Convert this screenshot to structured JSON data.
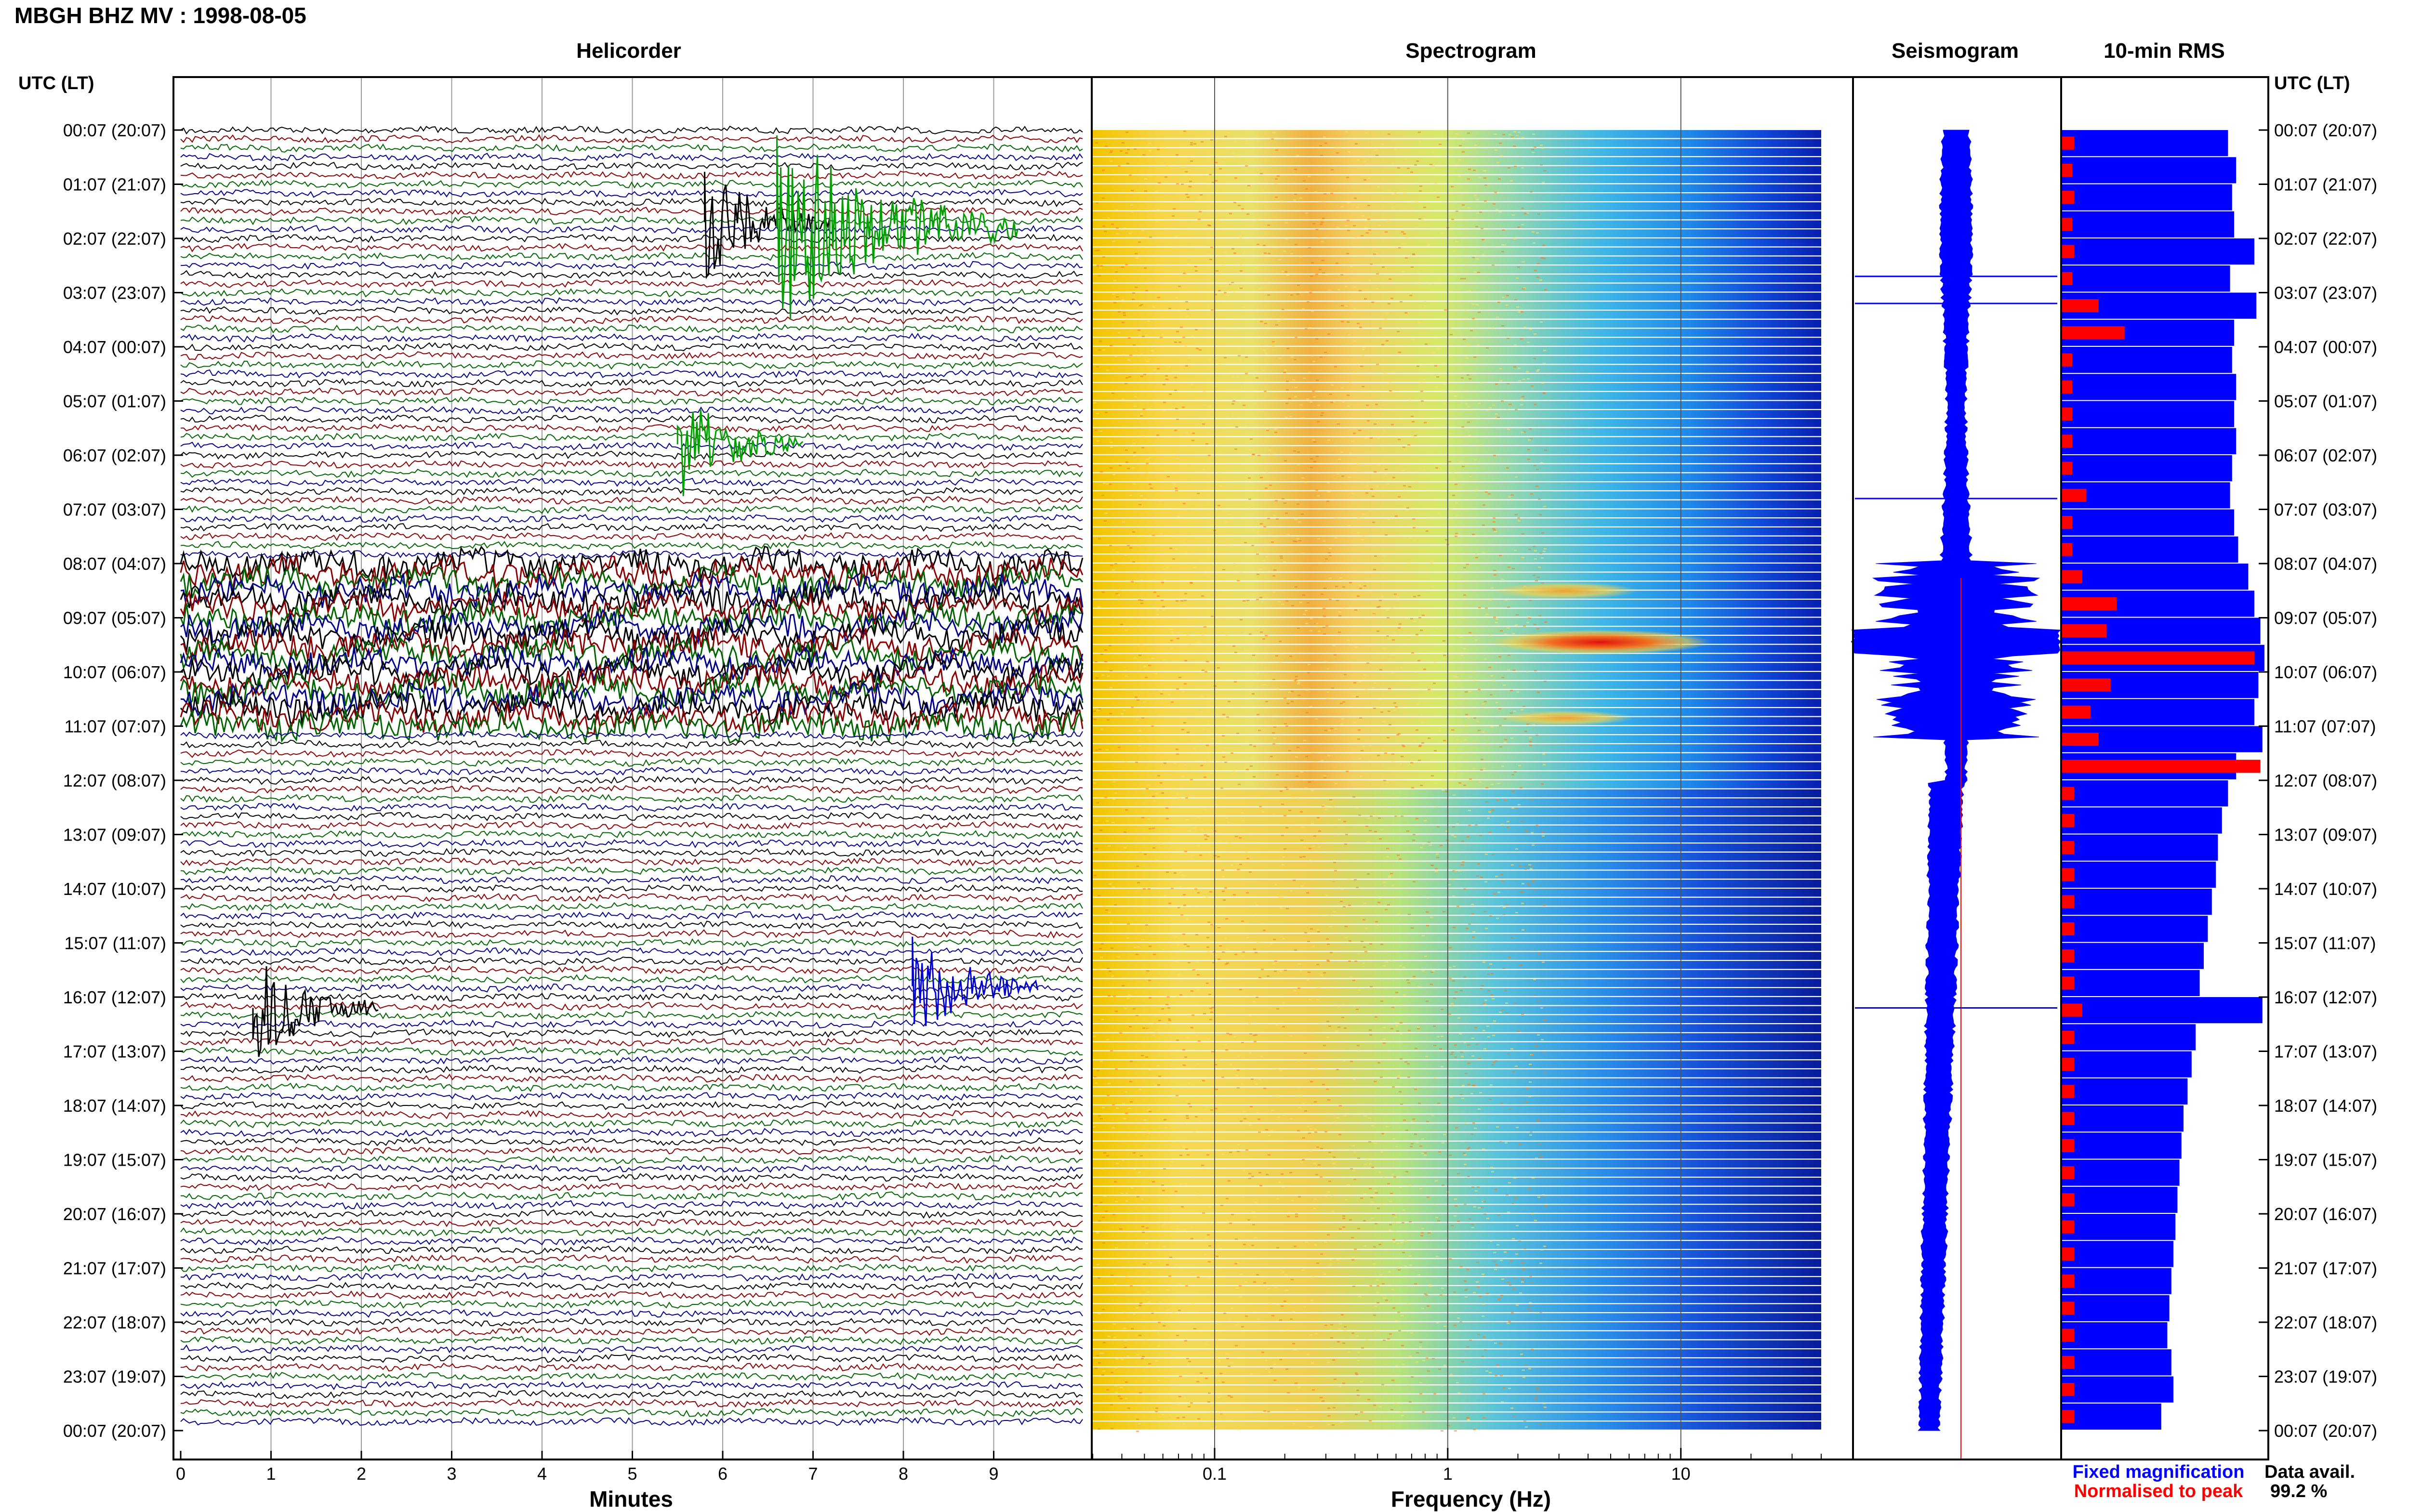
{
  "title": "MBGH BHZ MV : 1998-08-05",
  "panels": {
    "helicorder": "Helicorder",
    "spectrogram": "Spectrogram",
    "seismogram": "Seismogram",
    "rms": "10-min RMS"
  },
  "left_axis_label": "UTC (LT)",
  "right_axis_label": "UTC (LT)",
  "time_labels": [
    "00:07 (20:07)",
    "01:07 (21:07)",
    "02:07 (22:07)",
    "03:07 (23:07)",
    "04:07 (00:07)",
    "05:07 (01:07)",
    "06:07 (02:07)",
    "07:07 (03:07)",
    "08:07 (04:07)",
    "09:07 (05:07)",
    "10:07 (06:07)",
    "11:07 (07:07)",
    "12:07 (08:07)",
    "13:07 (09:07)",
    "14:07 (10:07)",
    "15:07 (11:07)",
    "16:07 (12:07)",
    "17:07 (13:07)",
    "18:07 (14:07)",
    "19:07 (15:07)",
    "20:07 (16:07)",
    "21:07 (17:07)",
    "22:07 (18:07)",
    "23:07 (19:07)",
    "00:07 (20:07)"
  ],
  "minutes_axis": {
    "label": "Minutes",
    "ticks": [
      "0",
      "1",
      "2",
      "3",
      "4",
      "5",
      "6",
      "7",
      "8",
      "9"
    ]
  },
  "frequency_axis": {
    "label": "Frequency (Hz)",
    "ticks": [
      "0.1",
      "1",
      "10"
    ],
    "scale": "log",
    "range": [
      0.03,
      40
    ]
  },
  "legend": {
    "fixed": "Fixed magnification",
    "normalised": "Normalised to peak",
    "fixed_color": "#0000ff",
    "normalised_color": "#ff0000"
  },
  "availability": {
    "label": "Data avail.",
    "value": "99.2 %"
  },
  "trace_colors": [
    "#000000",
    "#8b0000",
    "#006400",
    "#00008b"
  ],
  "chart_data": {
    "type": "heatmap",
    "x_minutes_range": [
      0,
      10
    ],
    "hours": 24,
    "events": [
      {
        "hour": 1.7,
        "minute": 5.8,
        "color": "black"
      },
      {
        "hour": 1.8,
        "minute": 6.6,
        "color": "green"
      },
      {
        "hour": 5.8,
        "minute": 5.5,
        "color": "green"
      },
      {
        "hour": 15.8,
        "minute": 8.1,
        "color": "blue"
      },
      {
        "hour": 16.2,
        "minute": 0.8,
        "color": "black"
      }
    ],
    "high_noise_hours": [
      8.0,
      11.0
    ],
    "rms_fixed": [
      {
        "hour": 0.0,
        "value": 0.82
      },
      {
        "hour": 0.5,
        "value": 0.86
      },
      {
        "hour": 1.0,
        "value": 0.84
      },
      {
        "hour": 1.5,
        "value": 0.85
      },
      {
        "hour": 2.0,
        "value": 0.95
      },
      {
        "hour": 2.5,
        "value": 0.83
      },
      {
        "hour": 3.0,
        "value": 0.96
      },
      {
        "hour": 3.5,
        "value": 0.85
      },
      {
        "hour": 4.0,
        "value": 0.84
      },
      {
        "hour": 4.5,
        "value": 0.86
      },
      {
        "hour": 5.0,
        "value": 0.85
      },
      {
        "hour": 5.5,
        "value": 0.86
      },
      {
        "hour": 6.0,
        "value": 0.84
      },
      {
        "hour": 6.5,
        "value": 0.83
      },
      {
        "hour": 7.0,
        "value": 0.85
      },
      {
        "hour": 7.5,
        "value": 0.87
      },
      {
        "hour": 8.0,
        "value": 0.92
      },
      {
        "hour": 8.5,
        "value": 0.95
      },
      {
        "hour": 9.0,
        "value": 0.98
      },
      {
        "hour": 9.5,
        "value": 1.0
      },
      {
        "hour": 10.0,
        "value": 0.97
      },
      {
        "hour": 10.5,
        "value": 0.95
      },
      {
        "hour": 11.0,
        "value": 0.99
      },
      {
        "hour": 11.5,
        "value": 0.86
      },
      {
        "hour": 12.0,
        "value": 0.82
      },
      {
        "hour": 12.5,
        "value": 0.79
      },
      {
        "hour": 13.0,
        "value": 0.77
      },
      {
        "hour": 13.5,
        "value": 0.76
      },
      {
        "hour": 14.0,
        "value": 0.74
      },
      {
        "hour": 14.5,
        "value": 0.72
      },
      {
        "hour": 15.0,
        "value": 0.7
      },
      {
        "hour": 15.5,
        "value": 0.68
      },
      {
        "hour": 16.0,
        "value": 0.99
      },
      {
        "hour": 16.5,
        "value": 0.66
      },
      {
        "hour": 17.0,
        "value": 0.64
      },
      {
        "hour": 17.5,
        "value": 0.62
      },
      {
        "hour": 18.0,
        "value": 0.6
      },
      {
        "hour": 18.5,
        "value": 0.59
      },
      {
        "hour": 19.0,
        "value": 0.58
      },
      {
        "hour": 19.5,
        "value": 0.57
      },
      {
        "hour": 20.0,
        "value": 0.56
      },
      {
        "hour": 20.5,
        "value": 0.55
      },
      {
        "hour": 21.0,
        "value": 0.54
      },
      {
        "hour": 21.5,
        "value": 0.53
      },
      {
        "hour": 22.0,
        "value": 0.52
      },
      {
        "hour": 22.5,
        "value": 0.54
      },
      {
        "hour": 23.0,
        "value": 0.55
      },
      {
        "hour": 23.5,
        "value": 0.49
      }
    ],
    "rms_normalised": [
      {
        "hour": 0.0,
        "value": 0.06
      },
      {
        "hour": 0.5,
        "value": 0.05
      },
      {
        "hour": 1.0,
        "value": 0.06
      },
      {
        "hour": 1.5,
        "value": 0.05
      },
      {
        "hour": 2.0,
        "value": 0.06
      },
      {
        "hour": 2.5,
        "value": 0.05
      },
      {
        "hour": 3.0,
        "value": 0.18
      },
      {
        "hour": 3.5,
        "value": 0.31
      },
      {
        "hour": 4.0,
        "value": 0.05
      },
      {
        "hour": 4.5,
        "value": 0.05
      },
      {
        "hour": 5.0,
        "value": 0.05
      },
      {
        "hour": 5.5,
        "value": 0.05
      },
      {
        "hour": 6.0,
        "value": 0.05
      },
      {
        "hour": 6.5,
        "value": 0.12
      },
      {
        "hour": 7.0,
        "value": 0.05
      },
      {
        "hour": 7.5,
        "value": 0.05
      },
      {
        "hour": 8.0,
        "value": 0.1
      },
      {
        "hour": 8.5,
        "value": 0.27
      },
      {
        "hour": 9.0,
        "value": 0.22
      },
      {
        "hour": 9.5,
        "value": 0.95
      },
      {
        "hour": 10.0,
        "value": 0.24
      },
      {
        "hour": 10.5,
        "value": 0.14
      },
      {
        "hour": 11.0,
        "value": 0.18
      },
      {
        "hour": 11.5,
        "value": 0.98
      },
      {
        "hour": 12.0,
        "value": 0.06
      },
      {
        "hour": 12.5,
        "value": 0.06
      },
      {
        "hour": 13.0,
        "value": 0.06
      },
      {
        "hour": 13.5,
        "value": 0.06
      },
      {
        "hour": 14.0,
        "value": 0.06
      },
      {
        "hour": 14.5,
        "value": 0.06
      },
      {
        "hour": 15.0,
        "value": 0.06
      },
      {
        "hour": 15.5,
        "value": 0.06
      },
      {
        "hour": 16.0,
        "value": 0.1
      },
      {
        "hour": 16.5,
        "value": 0.06
      },
      {
        "hour": 17.0,
        "value": 0.06
      },
      {
        "hour": 17.5,
        "value": 0.06
      },
      {
        "hour": 18.0,
        "value": 0.06
      },
      {
        "hour": 18.5,
        "value": 0.06
      },
      {
        "hour": 19.0,
        "value": 0.06
      },
      {
        "hour": 19.5,
        "value": 0.06
      },
      {
        "hour": 20.0,
        "value": 0.06
      },
      {
        "hour": 20.5,
        "value": 0.06
      },
      {
        "hour": 21.0,
        "value": 0.06
      },
      {
        "hour": 21.5,
        "value": 0.06
      },
      {
        "hour": 22.0,
        "value": 0.06
      },
      {
        "hour": 22.5,
        "value": 0.06
      },
      {
        "hour": 23.0,
        "value": 0.06
      },
      {
        "hour": 23.5,
        "value": 0.06
      }
    ]
  }
}
